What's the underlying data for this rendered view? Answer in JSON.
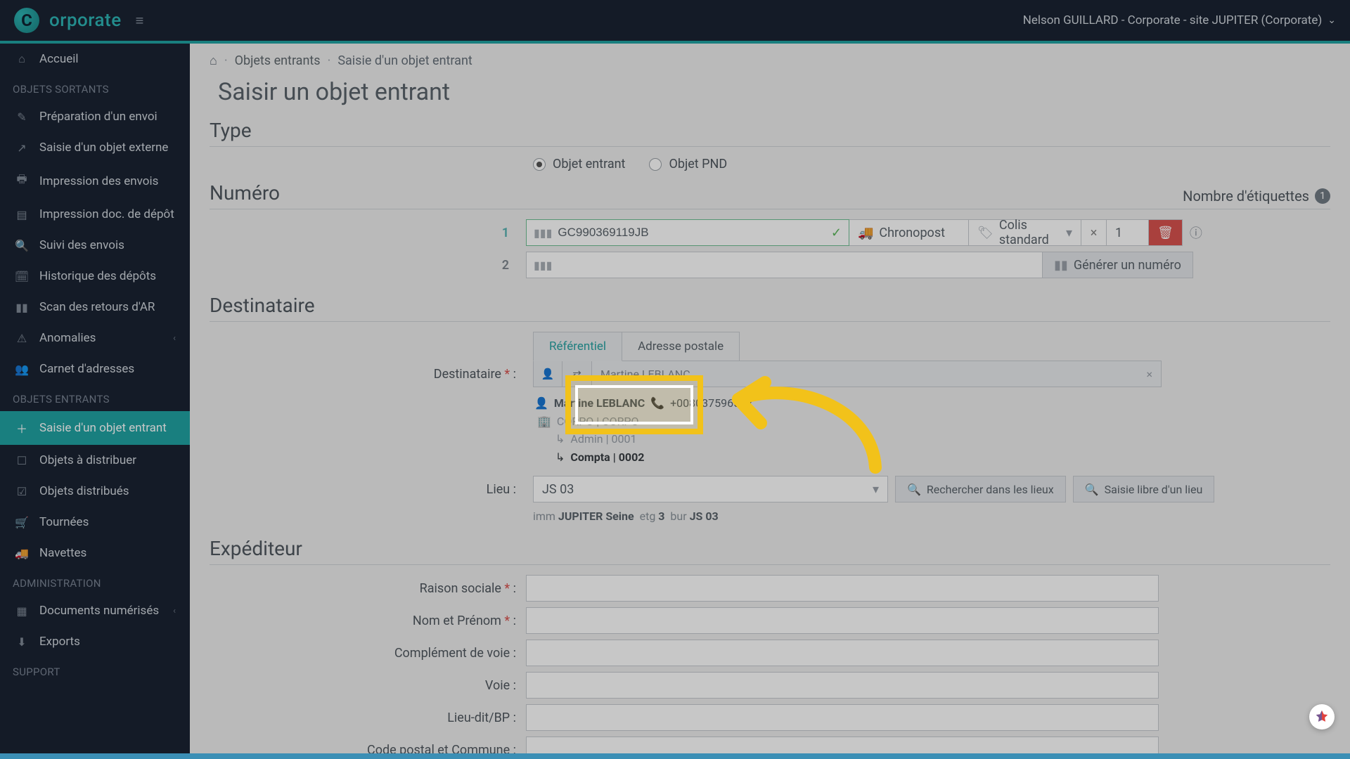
{
  "topbar": {
    "brand": "orporate",
    "user_context": "Nelson GUILLARD - Corporate - site JUPITER (Corporate)"
  },
  "sidebar": {
    "home": "Accueil",
    "section_out": "OBJETS SORTANTS",
    "out_items": [
      "Préparation d'un envoi",
      "Saisie d'un objet externe",
      "Impression des envois",
      "Impression doc. de dépôt",
      "Suivi des envois",
      "Historique des dépôts",
      "Scan des retours d'AR",
      "Anomalies",
      "Carnet d'adresses"
    ],
    "section_in": "OBJETS ENTRANTS",
    "in_items": [
      "Saisie d'un objet entrant",
      "Objets à distribuer",
      "Objets distribués",
      "Tournées",
      "Navettes"
    ],
    "section_admin": "ADMINISTRATION",
    "admin_items": [
      "Documents numérisés",
      "Exports"
    ],
    "section_support": "SUPPORT"
  },
  "breadcrumb": {
    "l1": "Objets entrants",
    "l2": "Saisie d'un objet entrant"
  },
  "page_title": "Saisir un objet entrant",
  "type_section": {
    "heading": "Type",
    "opt1": "Objet entrant",
    "opt2": "Objet PND"
  },
  "numero_section": {
    "heading": "Numéro",
    "labels_count_text": "Nombre d'étiquettes",
    "labels_count_value": "1",
    "rows": [
      {
        "idx": "1",
        "code": "GC990369119JB",
        "carrier": "Chronopost",
        "ptype": "Colis standard",
        "qty": "1"
      },
      {
        "idx": "2",
        "code": ""
      }
    ],
    "gen_btn": "Générer un numéro"
  },
  "dest_section": {
    "heading": "Destinataire",
    "tab_ref": "Référentiel",
    "tab_addr": "Adresse postale",
    "label": "Destinataire",
    "value_name": "Martine LEBLANC",
    "person": "Martine LEBLANC",
    "phone": "+008037596522",
    "org": "CORPO | CORPO",
    "svc1": "Admin | 0001",
    "svc2": "Compta | 0002",
    "lieu_label": "Lieu :",
    "lieu_value": "JS 03",
    "lieu_search": "Rechercher dans les lieux",
    "lieu_free": "Saisie libre d'un lieu",
    "lieu_path_imm": "imm",
    "lieu_path_imm_v": "JUPITER Seine",
    "lieu_path_etg": "etg",
    "lieu_path_etg_v": "3",
    "lieu_path_bur": "bur",
    "lieu_path_bur_v": "JS 03"
  },
  "exp_section": {
    "heading": "Expéditeur",
    "fields": [
      "Raison sociale",
      "Nom et Prénom",
      "Complément de voie :",
      "Voie :",
      "Lieu-dit/BP :",
      "Code postal et Commune :"
    ],
    "required": [
      true,
      true,
      false,
      false,
      false,
      false
    ]
  }
}
